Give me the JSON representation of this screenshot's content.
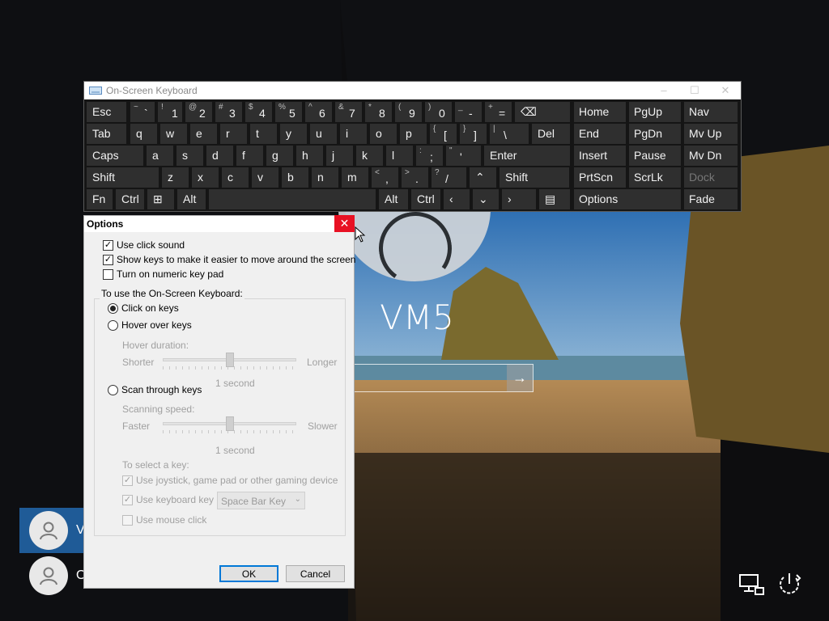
{
  "lockscreen": {
    "machine_name": "VM5",
    "submit_icon": "arrow-right-icon",
    "users": [
      {
        "label": "V",
        "selected": true
      },
      {
        "label": "O",
        "selected": false
      }
    ],
    "tray_icons": [
      "network-icon",
      "power-icon"
    ]
  },
  "osk": {
    "title": "On-Screen Keyboard",
    "title_buttons": [
      "–",
      "☐",
      "✕"
    ],
    "rows": [
      [
        {
          "solo": "Esc"
        },
        {
          "sup": "~",
          "main": "`"
        },
        {
          "sup": "!",
          "main": "1"
        },
        {
          "sup": "@",
          "main": "2"
        },
        {
          "sup": "#",
          "main": "3"
        },
        {
          "sup": "$",
          "main": "4"
        },
        {
          "sup": "%",
          "main": "5"
        },
        {
          "sup": "^",
          "main": "6"
        },
        {
          "sup": "&",
          "main": "7"
        },
        {
          "sup": "*",
          "main": "8"
        },
        {
          "sup": "(",
          "main": "9"
        },
        {
          "sup": ")",
          "main": "0"
        },
        {
          "sup": "_",
          "main": "-"
        },
        {
          "sup": "+",
          "main": "="
        },
        {
          "solo": "⌫"
        }
      ],
      [
        {
          "solo": "Tab"
        },
        {
          "solo": "q"
        },
        {
          "solo": "w"
        },
        {
          "solo": "e"
        },
        {
          "solo": "r"
        },
        {
          "solo": "t"
        },
        {
          "solo": "y"
        },
        {
          "solo": "u"
        },
        {
          "solo": "i"
        },
        {
          "solo": "o"
        },
        {
          "solo": "p"
        },
        {
          "sup": "{",
          "main": "["
        },
        {
          "sup": "}",
          "main": "]"
        },
        {
          "sup": "|",
          "main": "\\"
        },
        {
          "solo": "Del"
        }
      ],
      [
        {
          "solo": "Caps"
        },
        {
          "solo": "a"
        },
        {
          "solo": "s"
        },
        {
          "solo": "d"
        },
        {
          "solo": "f"
        },
        {
          "solo": "g"
        },
        {
          "solo": "h"
        },
        {
          "solo": "j"
        },
        {
          "solo": "k"
        },
        {
          "solo": "l"
        },
        {
          "sup": ":",
          "main": ";"
        },
        {
          "sup": "\"",
          "main": "'"
        },
        {
          "solo": "Enter"
        }
      ],
      [
        {
          "solo": "Shift"
        },
        {
          "solo": "z"
        },
        {
          "solo": "x"
        },
        {
          "solo": "c"
        },
        {
          "solo": "v"
        },
        {
          "solo": "b"
        },
        {
          "solo": "n"
        },
        {
          "solo": "m"
        },
        {
          "sup": "<",
          "main": ","
        },
        {
          "sup": ">",
          "main": "."
        },
        {
          "sup": "?",
          "main": "/"
        },
        {
          "solo": "⌃"
        },
        {
          "solo": "Shift"
        }
      ],
      [
        {
          "solo": "Fn"
        },
        {
          "solo": "Ctrl"
        },
        {
          "solo": "⊞"
        },
        {
          "solo": "Alt"
        },
        {
          "solo": ""
        },
        {
          "solo": "Alt"
        },
        {
          "solo": "Ctrl"
        },
        {
          "solo": "‹"
        },
        {
          "solo": "⌄"
        },
        {
          "solo": "›"
        },
        {
          "solo": "▤"
        }
      ]
    ],
    "nav_keys": [
      [
        "Home",
        "PgUp",
        "Nav"
      ],
      [
        "End",
        "PgDn",
        "Mv Up"
      ],
      [
        "Insert",
        "Pause",
        "Mv Dn"
      ],
      [
        "PrtScn",
        "ScrLk",
        "Dock"
      ],
      [
        "Options",
        "Fade"
      ]
    ]
  },
  "options": {
    "title": "Options",
    "use_click_sound": {
      "label": "Use click sound",
      "checked": true
    },
    "show_keys": {
      "label": "Show keys to make it easier to move around the screen",
      "checked": true
    },
    "numeric_pad": {
      "label": "Turn on numeric key pad",
      "checked": false
    },
    "group_label": "To use the On-Screen Keyboard:",
    "click_on_keys": {
      "label": "Click on keys",
      "selected": true
    },
    "hover_over_keys": {
      "label": "Hover over keys",
      "selected": false
    },
    "hover_duration": {
      "label": "Hover duration:",
      "min_label": "Shorter",
      "max_label": "Longer",
      "value_label": "1 second",
      "level": 0.5
    },
    "scan_through_keys": {
      "label": "Scan through keys",
      "selected": false
    },
    "scanning_speed": {
      "label": "Scanning speed:",
      "min_label": "Faster",
      "max_label": "Slower",
      "value_label": "1 second",
      "level": 0.5
    },
    "select_key_label": "To select a key:",
    "use_joystick": {
      "label": "Use joystick, game pad or other gaming device",
      "checked": true
    },
    "use_keyboard_key": {
      "label": "Use keyboard key",
      "checked": true
    },
    "keyboard_key_value": "Space Bar Key",
    "use_mouse_click": {
      "label": "Use mouse click",
      "checked": false
    },
    "ok_label": "OK",
    "cancel_label": "Cancel"
  }
}
